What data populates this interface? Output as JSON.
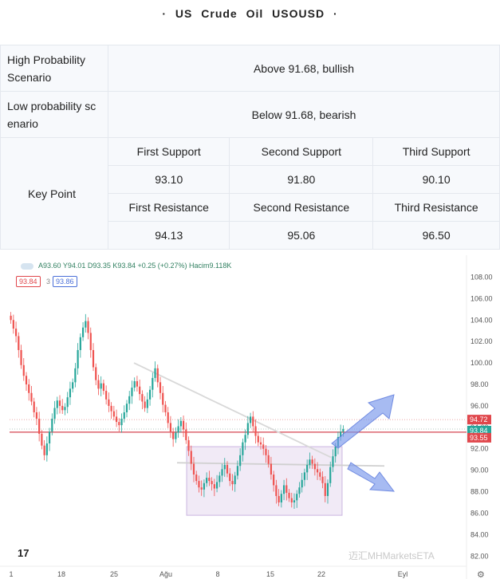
{
  "title": "· US  Crude  Oil  USOUSD ·",
  "table": {
    "high_label": "High Probability Scenario",
    "high_value": "Above 91.68, bullish",
    "low_label": "Low probability sc enario",
    "low_value": "Below 91.68, bearish",
    "key_label": "Key Point",
    "support_headers": [
      "First Support",
      "Second Support",
      "Third Support"
    ],
    "support_values": [
      "93.10",
      "91.80",
      "90.10"
    ],
    "resistance_headers": [
      "First Resistance",
      "Second Resistance",
      "Third Resistance"
    ],
    "resistance_values": [
      "94.13",
      "95.06",
      "96.50"
    ]
  },
  "chart_legend": {
    "ohlc": "A93.60 Y94.01 D93.35 K93.84 +0.25 (+0.27%) Hacim9.118K",
    "box1": "93.84",
    "box_mid": "3",
    "box2": "93.86"
  },
  "watermark": "迈汇MHMarketsETA",
  "chart_data": {
    "type": "candlestick",
    "y_ticks": [
      "108.00",
      "106.00",
      "104.00",
      "102.00",
      "100.00",
      "98.00",
      "96.00",
      "94.00",
      "92.00",
      "90.00",
      "88.00",
      "86.00",
      "84.00",
      "82.00"
    ],
    "ylim": [
      81.5,
      109.0
    ],
    "x_ticks": [
      "1",
      "18",
      "25",
      "Ağu",
      "8",
      "15",
      "22",
      "Eyl"
    ],
    "price_labels": [
      {
        "value": 94.72,
        "text": "94.72",
        "color": "#e0474c"
      },
      {
        "value": 93.84,
        "text": "93.84",
        "color": "#26a69a"
      },
      {
        "value": 93.55,
        "text": "93.55",
        "color": "#e0474c"
      }
    ],
    "horizontal_levels": [
      93.55,
      94.72
    ],
    "closes": [
      104.0,
      103.2,
      102.5,
      101.2,
      99.8,
      98.8,
      98.0,
      97.2,
      96.4,
      95.4,
      94.8,
      93.4,
      92.3,
      91.4,
      92.5,
      93.6,
      94.8,
      95.8,
      96.5,
      96.0,
      95.6,
      95.9,
      96.8,
      97.6,
      98.2,
      99.5,
      101.2,
      102.4,
      103.3,
      103.9,
      102.8,
      101.2,
      99.6,
      98.4,
      97.6,
      98.1,
      97.4,
      96.6,
      96.0,
      95.5,
      95.0,
      94.5,
      94.2,
      94.8,
      95.4,
      96.2,
      96.9,
      97.7,
      98.3,
      97.8,
      97.1,
      96.4,
      95.8,
      96.6,
      97.5,
      98.6,
      99.5,
      98.2,
      97.2,
      96.1,
      95.4,
      94.4,
      93.6,
      92.9,
      93.5,
      94.1,
      94.6,
      93.8,
      92.8,
      91.8,
      90.6,
      89.6,
      89.0,
      88.4,
      88.2,
      88.8,
      89.3,
      89.0,
      88.7,
      88.3,
      88.9,
      89.5,
      90.1,
      90.5,
      89.7,
      89.0,
      88.7,
      89.5,
      90.4,
      91.4,
      92.6,
      93.3,
      94.4,
      95.0,
      94.1,
      93.2,
      92.6,
      92.4,
      92.0,
      91.4,
      90.6,
      89.6,
      88.6,
      87.6,
      87.0,
      87.8,
      88.6,
      87.9,
      87.4,
      87.0,
      87.2,
      87.8,
      88.4,
      89.1,
      89.8,
      90.5,
      91.0,
      90.6,
      90.1,
      89.8,
      89.4,
      88.8,
      87.6,
      88.8,
      90.3,
      91.3,
      92.2,
      93.1,
      93.6,
      93.84
    ]
  }
}
